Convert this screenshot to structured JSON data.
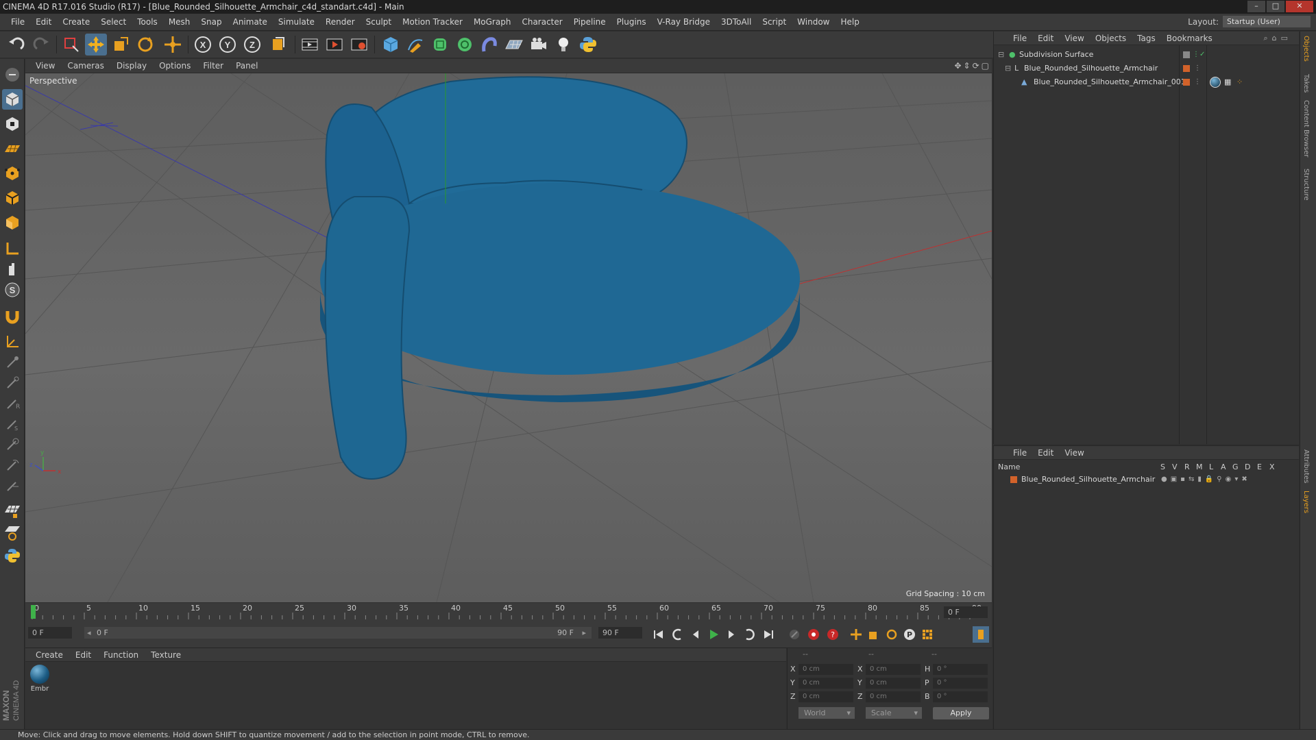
{
  "title": "CINEMA 4D R17.016 Studio (R17) - [Blue_Rounded_Silhouette_Armchair_c4d_standart.c4d] - Main",
  "menu": [
    "File",
    "Edit",
    "Create",
    "Select",
    "Tools",
    "Mesh",
    "Snap",
    "Animate",
    "Simulate",
    "Render",
    "Sculpt",
    "Motion Tracker",
    "MoGraph",
    "Character",
    "Pipeline",
    "Plugins",
    "V-Ray Bridge",
    "3DToAll",
    "Script",
    "Window",
    "Help"
  ],
  "layout": {
    "label": "Layout:",
    "value": "Startup (User)"
  },
  "viewport": {
    "menu": [
      "View",
      "Cameras",
      "Display",
      "Options",
      "Filter",
      "Panel"
    ],
    "label": "Perspective",
    "grid_spacing": "Grid Spacing : 10 cm",
    "axis_label_x": "x",
    "axis_label_y": "y",
    "axis_label_z": "z"
  },
  "timeline": {
    "ticks": [
      "0",
      "5",
      "10",
      "15",
      "20",
      "25",
      "30",
      "35",
      "40",
      "45",
      "50",
      "55",
      "60",
      "65",
      "70",
      "75",
      "80",
      "85",
      "90"
    ],
    "current_frame": "0 F"
  },
  "frames": {
    "start": "0 F",
    "range_start": "0 F",
    "range_end": "90 F",
    "end": "90 F"
  },
  "material_manager": {
    "menu": [
      "Create",
      "Edit",
      "Function",
      "Texture"
    ],
    "material_label": "Embr"
  },
  "coordinates": {
    "headers": [
      "--",
      "--",
      "--"
    ],
    "rows": [
      {
        "a": "X",
        "v1": "0 cm",
        "b": "X",
        "v2": "0 cm",
        "c": "H",
        "v3": "0 °"
      },
      {
        "a": "Y",
        "v1": "0 cm",
        "b": "Y",
        "v2": "0 cm",
        "c": "P",
        "v3": "0 °"
      },
      {
        "a": "Z",
        "v1": "0 cm",
        "b": "Z",
        "v2": "0 cm",
        "c": "B",
        "v3": "0 °"
      }
    ],
    "space": "World",
    "mode": "Scale",
    "apply": "Apply"
  },
  "object_manager": {
    "menu": [
      "File",
      "Edit",
      "View",
      "Objects",
      "Tags",
      "Bookmarks"
    ],
    "objects": [
      {
        "name": "Subdivision Surface"
      },
      {
        "name": "Blue_Rounded_Silhouette_Armchair"
      },
      {
        "name": "Blue_Rounded_Silhouette_Armchair_001"
      }
    ]
  },
  "layer_manager": {
    "menu": [
      "File",
      "Edit",
      "View"
    ],
    "columns": [
      "Name",
      "S",
      "V",
      "R",
      "M",
      "L",
      "A",
      "G",
      "D",
      "E",
      "X"
    ],
    "layers": [
      {
        "name": "Blue_Rounded_Silhouette_Armchair"
      }
    ]
  },
  "side_tabs": [
    "Objects",
    "Takes",
    "Content Browser",
    "Structure",
    "Attributes",
    "Layers"
  ],
  "status": "Move: Click and drag to move elements. Hold down SHIFT to quantize movement / add to the selection in point mode, CTRL to remove.",
  "maxon_logo": "MAXON CINEMA 4D",
  "colors": {
    "accent": "#2e7fb4",
    "chair": "#1f6a96",
    "layer_swatch": "#d2622a"
  }
}
